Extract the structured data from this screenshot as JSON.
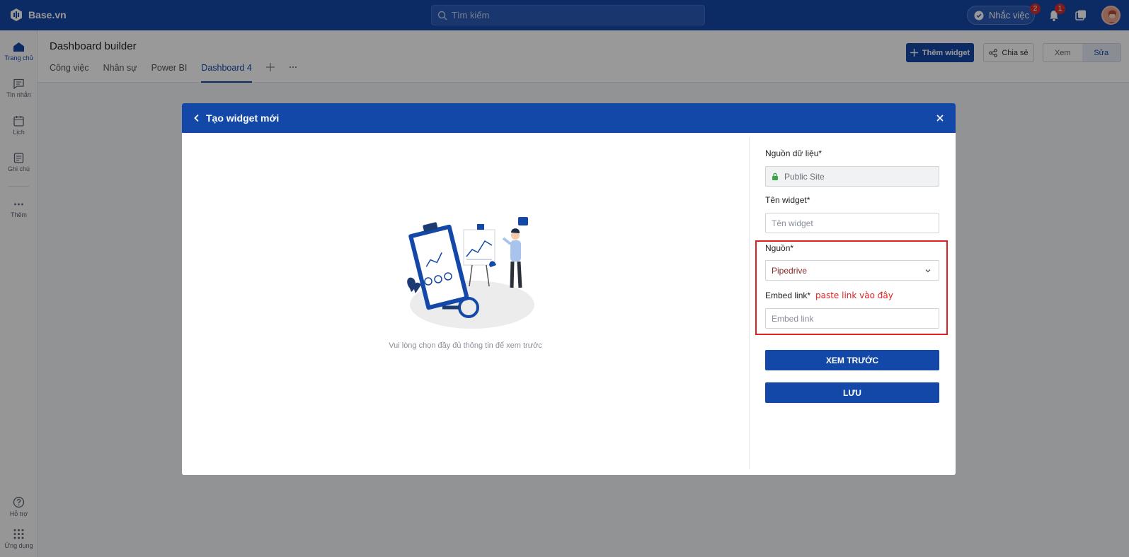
{
  "app": {
    "logo_text": "Base.vn",
    "search_placeholder": "Tìm kiếm",
    "remind_label": "Nhắc việc",
    "remind_badge": "2",
    "bell_badge": "1"
  },
  "sidebar": {
    "items": [
      {
        "label": "Trang chủ"
      },
      {
        "label": "Tin nhắn"
      },
      {
        "label": "Lịch"
      },
      {
        "label": "Ghi chú"
      },
      {
        "label": "Thêm"
      },
      {
        "label": "Hỗ trợ"
      },
      {
        "label": "Ứng dụng"
      }
    ]
  },
  "header": {
    "title": "Dashboard builder",
    "tabs": [
      {
        "label": "Công việc"
      },
      {
        "label": "Nhân sự"
      },
      {
        "label": "Power BI"
      },
      {
        "label": "Dashboard 4"
      }
    ],
    "add_widget_label": "Thêm widget",
    "share_label": "Chia sẻ",
    "view_label": "Xem",
    "edit_label": "Sửa"
  },
  "modal": {
    "title": "Tạo widget mới",
    "preview_hint": "Vui lòng chọn đầy đủ thông tin để xem trước",
    "data_source_label": "Nguồn dữ liệu*",
    "data_source_value": "Public Site",
    "widget_name_label": "Tên widget*",
    "widget_name_placeholder": "Tên widget",
    "source_label": "Nguồn*",
    "source_value": "Pipedrive",
    "embed_label": "Embed link*",
    "embed_annotation": "paste link vào đây",
    "embed_placeholder": "Embed link",
    "preview_button": "XEM TRƯỚC",
    "save_button": "LƯU"
  },
  "colors": {
    "brand": "#1448a8",
    "annotation": "#e02020"
  }
}
